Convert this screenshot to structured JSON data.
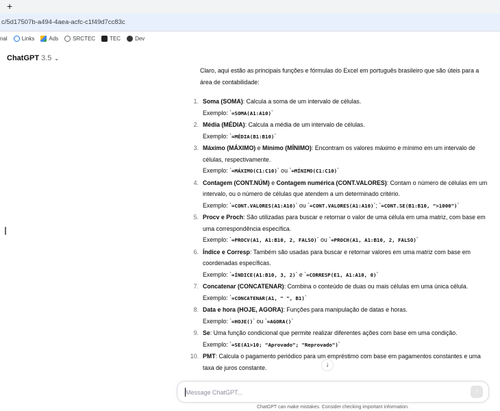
{
  "browser": {
    "new_tab_symbol": "+",
    "url": "c/5d17507b-a494-4aea-acfc-c1f49d7cc83c",
    "bookmarks": [
      {
        "label": "nal",
        "icon": "none"
      },
      {
        "label": "Links",
        "icon": "links-icon"
      },
      {
        "label": "Ads",
        "icon": "google-ads-icon"
      },
      {
        "label": "SRCTEC",
        "icon": "srctec-icon"
      },
      {
        "label": "TEC",
        "icon": "tec-icon"
      },
      {
        "label": "Dev",
        "icon": "github-icon"
      }
    ]
  },
  "header": {
    "app_name": "ChatGPT",
    "version": "3.5",
    "chevron": "⌄"
  },
  "message": {
    "intro": "Claro, aqui estão as principais funções e fórmulas do Excel em português brasileiro que são úteis para a área de contabilidade:",
    "example_prefix": "Exemplo: ",
    "items": [
      {
        "num": "1.",
        "html": "<b>Soma (SOMA)</b>: Calcula a soma de um intervalo de células.",
        "example": "`<code>=SOMA(A1:A10)</code>`"
      },
      {
        "num": "2.",
        "html": "<b>Média (MÉDIA)</b>: Calcula a média de um intervalo de células.",
        "example": "`<code>=MÉDIA(B1:B10)</code>`"
      },
      {
        "num": "3.",
        "html": "<b>Máximo (MÁXIMO)</b> e <b>Mínimo (MÍNIMO)</b>: Encontram os valores máximo e mínimo em um intervalo de células, respectivamente.",
        "example": "`<code>=MÁXIMO(C1:C10)</code>` ou `<code>=MÍNIMO(C1:C10)</code>`"
      },
      {
        "num": "4.",
        "html": "<b>Contagem (CONT.NÚM)</b> e <b>Contagem numérica (CONT.VALORES)</b>: Contam o número de células em um intervalo, ou o número de células que atendem a um determinado critério.",
        "example": "`<code>=CONT.VALORES(A1:A10)</code>` ou `<code>=CONT.VALORES(A1:A10)</code>`; `<code>=CONT.SE(B1:B10, \">1000\")</code>`"
      },
      {
        "num": "5.",
        "html": "<b>Procv e Proch</b>: São utilizadas para buscar e retornar o valor de uma célula em uma matriz, com base em uma correspondência específica.",
        "example": "`<code>=PROCV(A1, A1:B10, 2, FALSO)</code>` ou `<code>=PROCH(A1, A1:B10, 2, FALSO)</code>`"
      },
      {
        "num": "6.",
        "html": "<b>Índice e Corresp</b>: Também são usadas para buscar e retornar valores em uma matriz com base em coordenadas específicas.",
        "example": "`<code>=ÍNDICE(A1:B10, 3, 2)</code>` e `<code>=CORRESP(E1, A1:A10, 0)</code>`"
      },
      {
        "num": "7.",
        "html": "<b>Concatenar (CONCATENAR)</b>: Combina o conteúdo de duas ou mais células em uma única célula.",
        "example": "`<code>=CONCATENAR(A1, \" \", B1)</code>`"
      },
      {
        "num": "8.",
        "html": "<b>Data e hora (HOJE, AGORA)</b>: Funções para manipulação de datas e horas.",
        "example": "`<code>=HOJE()</code>` ou `<code>=AGORA()</code>`"
      },
      {
        "num": "9.",
        "html": "<b>Se</b>: Uma função condicional que permite realizar diferentes ações com base em uma condição.",
        "example": "`<code>=SE(A1>10; \"Aprovado\"; \"Reprovado\")</code>`"
      },
      {
        "num": "10.",
        "html": "<b>PMT</b>: Calcula o pagamento periódico para um empréstimo com base em pagamentos constantes e uma taxa de juros constante.",
        "example": ""
      }
    ]
  },
  "composer": {
    "placeholder": "Message ChatGPT...",
    "value": "",
    "send_symbol": "↑",
    "scroll_down_symbol": "↓",
    "disclaimer": "ChatGPT can make mistakes. Consider checking important information."
  }
}
